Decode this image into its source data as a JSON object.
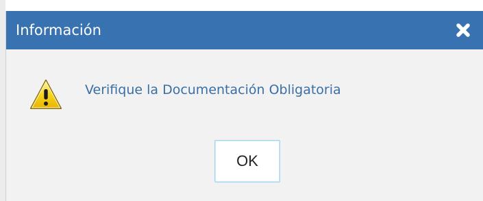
{
  "dialog": {
    "title": "Información",
    "message": "Verifique la Documentación Obligatoria",
    "ok_label": "OK",
    "icons": {
      "close": "close-icon",
      "warning": "warning-icon"
    }
  },
  "colors": {
    "titlebar": "#3872b1",
    "message_text": "#3a6ea5",
    "body_background": "#f2f2f2",
    "button_border": "#9ed4f0",
    "warning_fill": "#f7d21a"
  }
}
